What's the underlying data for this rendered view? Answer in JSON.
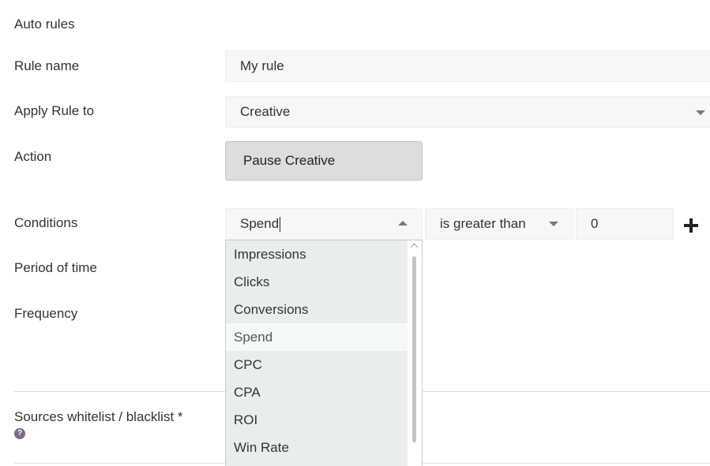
{
  "section_title": "Auto rules",
  "rule_name": {
    "label": "Rule name",
    "value": "My rule"
  },
  "apply_rule": {
    "label": "Apply Rule to",
    "value": "Creative"
  },
  "action": {
    "label": "Action",
    "button_label": "Pause Creative"
  },
  "conditions": {
    "label": "Conditions",
    "metric_value": "Spend",
    "operator_value": "is greater than",
    "threshold_value": "0",
    "add_icon": "plus-icon",
    "dropdown_options": [
      "Impressions",
      "Clicks",
      "Conversions",
      "Spend",
      "CPC",
      "CPA",
      "ROI",
      "Win Rate"
    ],
    "selected_option": "Spend"
  },
  "period": {
    "label": "Period of time"
  },
  "frequency": {
    "label": "Frequency"
  },
  "sources": {
    "label": "Sources whitelist / blacklist",
    "required_marker": "*",
    "help_icon": "question-circle-icon",
    "help_glyph": "?"
  },
  "colors": {
    "field_bg": "#f7f7f7",
    "button_bg": "#dddddd",
    "dropdown_bg": "#eaedee",
    "selected_bg": "#f6f9fa",
    "help_icon": "#7e6a8f"
  }
}
